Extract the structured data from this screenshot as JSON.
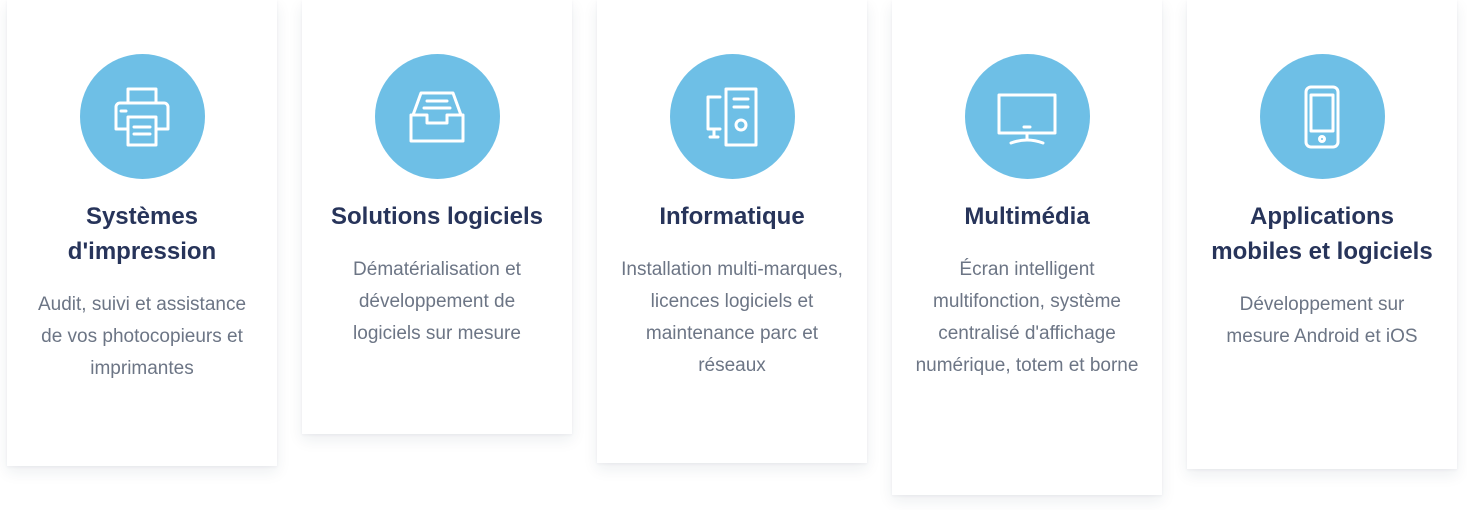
{
  "colors": {
    "icon_background": "#6ebfe6",
    "title": "#27345a",
    "description": "#6c7585"
  },
  "services": [
    {
      "icon": "printer-icon",
      "title": "Systèmes d'impression",
      "description": "Audit, suivi et assistance de vos photocopieurs et imprimantes"
    },
    {
      "icon": "inbox-tray-icon",
      "title": "Solutions logiciels",
      "description": "Dématérialisation et développement de logiciels sur mesure"
    },
    {
      "icon": "computer-tower-icon",
      "title": "Informatique",
      "description": "Installation multi-marques, licences logiciels et maintenance parc et réseaux"
    },
    {
      "icon": "monitor-icon",
      "title": "Multimédia",
      "description": "Écran intelligent multifonction, système centralisé d'affichage numérique, totem et borne"
    },
    {
      "icon": "smartphone-icon",
      "title": "Applications mobiles et logiciels",
      "description": "Développement sur mesure Android et iOS"
    }
  ]
}
